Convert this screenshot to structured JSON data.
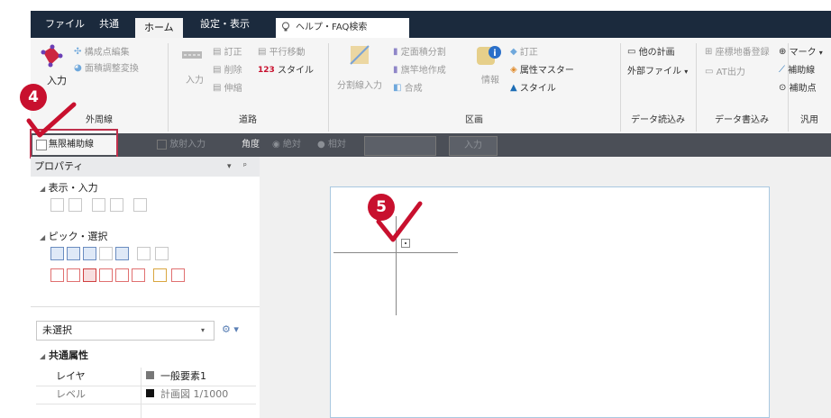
{
  "menu": {
    "items": [
      "ファイル",
      "共通",
      "ホーム",
      "設定・表示"
    ],
    "active": "ホーム",
    "search_placeholder": "ヘルプ・FAQ検索"
  },
  "ribbon": {
    "groups": {
      "outer": {
        "label": "外周線",
        "input": "入力",
        "edit_vertex": "構成点編集",
        "area_adjust": "面積調整変換"
      },
      "road": {
        "label": "道路",
        "input": "入力",
        "revise": "訂正",
        "parallel": "平行移動",
        "delete": "削除",
        "style": "スタイル",
        "shrink": "伸縮"
      },
      "block": {
        "label": "区画",
        "divide_input": "分割線入力",
        "fixed_area": "定面積分割",
        "flag_lot": "旗竿地作成",
        "merge": "合成",
        "info": "情報",
        "revise": "訂正",
        "attr_master": "属性マスター",
        "style": "スタイル"
      },
      "data_read": {
        "label": "データ読込み",
        "other_plan": "他の計画",
        "external_file": "外部ファイル"
      },
      "data_write": {
        "label": "データ書込み",
        "coord_register": "座標地番登録",
        "at_output": "AT出力"
      },
      "general": {
        "label": "汎用",
        "mark": "マーク",
        "aux_line": "補助線",
        "aux_point": "補助点"
      }
    }
  },
  "options": {
    "infinite_aux": "無限補助線",
    "radial_input": "放射入力",
    "angle_label": "角度",
    "absolute": "絶対",
    "relative": "相対",
    "input_button": "入力"
  },
  "panel": {
    "title": "プロパティ",
    "display_input": "表示・入力",
    "pick_select": "ピック・選択",
    "selection_value": "未選択",
    "common_attrs": "共通属性",
    "rows": [
      {
        "key": "レイヤ",
        "value": "一般要素1"
      },
      {
        "key": "レベル",
        "value": "計画図 1/1000"
      }
    ]
  },
  "annotations": {
    "step4": "4",
    "step5": "5"
  },
  "colors": {
    "menubar": "#1b2a3d",
    "accent_red": "#c8102e",
    "highlight_border": "#c0304c"
  }
}
